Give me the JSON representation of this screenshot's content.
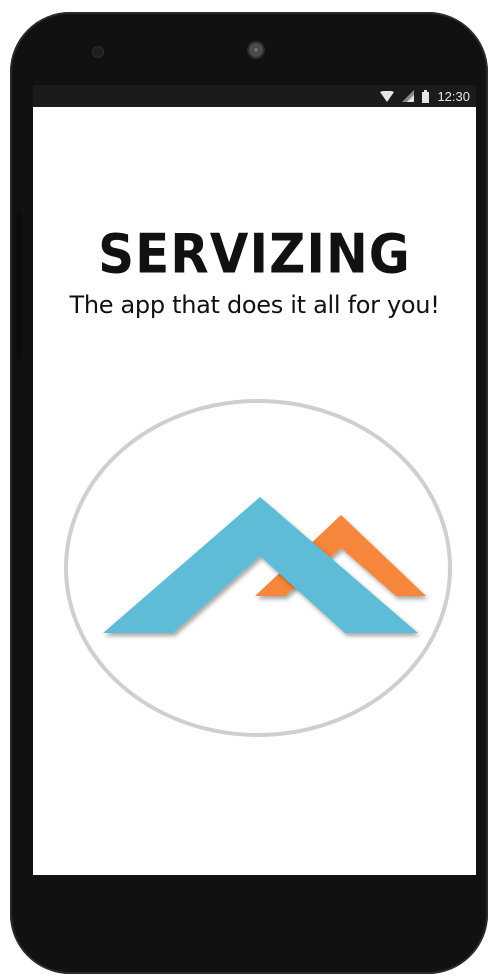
{
  "status_bar": {
    "time": "12:30",
    "icons": [
      "wifi-icon",
      "signal-icon",
      "battery-icon"
    ]
  },
  "splash": {
    "title": "SERVIZING",
    "subtitle": "The app that does it all for you!"
  },
  "logo": {
    "icon": "house-roof-logo-icon",
    "colors": {
      "primary_roof": "#5fbcd6",
      "secondary_roof": "#f5863a",
      "ring": "#cfcfcf"
    }
  }
}
